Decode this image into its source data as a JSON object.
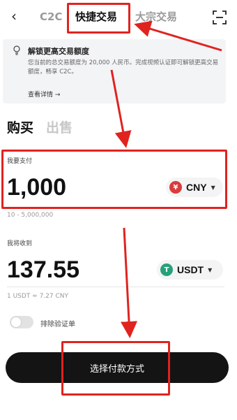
{
  "nav": {
    "tabs": [
      "C2C",
      "快捷交易",
      "大宗交易"
    ]
  },
  "banner": {
    "title": "解锁更高交易额度",
    "description": "您当前的总交易额度为 20,000 人民币。完成视频认证即可解锁更高交易额度，畅享 C2C。",
    "link": "查看详情 →"
  },
  "sides": {
    "buy": "购买",
    "sell": "出售"
  },
  "pay": {
    "label": "我要支付",
    "amount": "1,000",
    "currency": "CNY",
    "currency_symbol": "¥",
    "range": "10 - 5,000,000"
  },
  "receive": {
    "label": "我将收到",
    "amount": "137.55",
    "currency": "USDT",
    "currency_symbol": "T",
    "rate": "1 USDT ≈ 7.27 CNY"
  },
  "toggle": {
    "label": "排除验证单",
    "on": false
  },
  "cta": {
    "label": "选择付款方式"
  },
  "colors": {
    "annotation": "#e0231f",
    "cny_coin": "#d83c3c",
    "usdt_coin": "#26a17b",
    "cta_bg": "#141414"
  },
  "icons": [
    "back-arrow-icon",
    "scan-icon",
    "lightbulb-icon",
    "cny-coin-icon",
    "usdt-coin-icon",
    "chevron-down-icon"
  ]
}
